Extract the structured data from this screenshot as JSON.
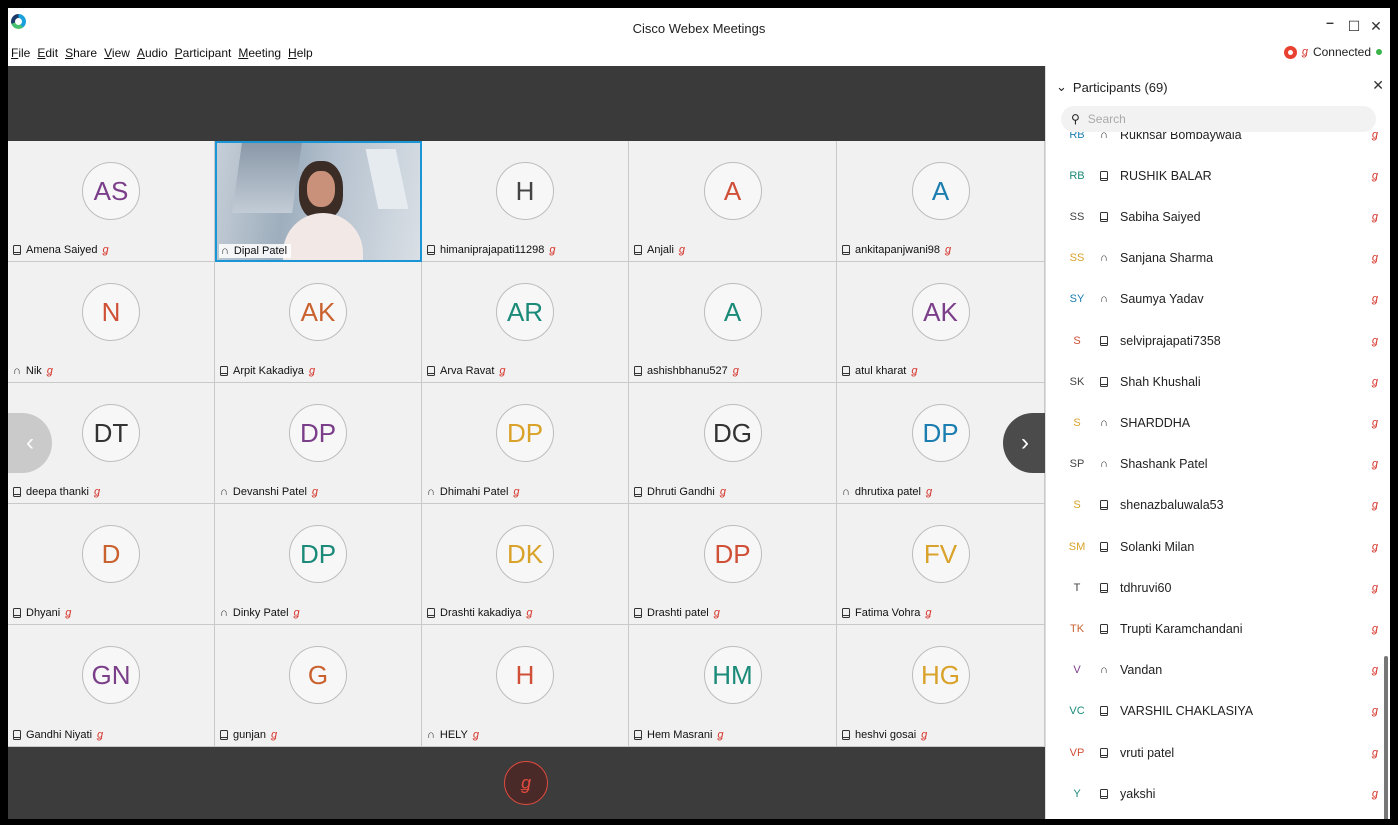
{
  "app": {
    "title": "Cisco Webex Meetings"
  },
  "menu": [
    "File",
    "Edit",
    "Share",
    "View",
    "Audio",
    "Participant",
    "Meeting",
    "Help"
  ],
  "menu_underline": [
    "F",
    "E",
    "S",
    "V",
    "A",
    "P",
    "M",
    "H"
  ],
  "status": {
    "label": "Connected"
  },
  "grid": [
    {
      "initials": "AS",
      "name": "Amena Saiyed",
      "color": "#7b3f8a",
      "device": "phone",
      "muted": true
    },
    {
      "initials": "",
      "name": "Dipal Patel",
      "color": "#333333",
      "device": "headset",
      "muted": false,
      "video": true
    },
    {
      "initials": "H",
      "name": "himaniprajapati11298",
      "color": "#444444",
      "device": "phone",
      "muted": true
    },
    {
      "initials": "A",
      "name": "Anjali",
      "color": "#d04f37",
      "device": "phone",
      "muted": true
    },
    {
      "initials": "A",
      "name": "ankitapanjwani98",
      "color": "#1c7eb0",
      "device": "phone",
      "muted": true
    },
    {
      "initials": "N",
      "name": "Nik",
      "color": "#d04f37",
      "device": "headset",
      "muted": true
    },
    {
      "initials": "AK",
      "name": "Arpit Kakadiya",
      "color": "#c9622f",
      "device": "phone",
      "muted": true
    },
    {
      "initials": "AR",
      "name": "Arva Ravat",
      "color": "#1b8a78",
      "device": "phone",
      "muted": true
    },
    {
      "initials": "A",
      "name": "ashishbhanu527",
      "color": "#1b8a78",
      "device": "phone",
      "muted": true
    },
    {
      "initials": "AK",
      "name": "atul kharat",
      "color": "#7b3f8a",
      "device": "phone",
      "muted": true
    },
    {
      "initials": "DT",
      "name": "deepa thanki",
      "color": "#333333",
      "device": "phone",
      "muted": true
    },
    {
      "initials": "DP",
      "name": "Devanshi Patel",
      "color": "#7b3f8a",
      "device": "headset",
      "muted": true
    },
    {
      "initials": "DP",
      "name": "Dhimahi Patel",
      "color": "#d9a22a",
      "device": "headset",
      "muted": true
    },
    {
      "initials": "DG",
      "name": "Dhruti Gandhi",
      "color": "#333333",
      "device": "phone",
      "muted": true
    },
    {
      "initials": "DP",
      "name": "dhrutixa patel",
      "color": "#1c7eb0",
      "device": "headset",
      "muted": true
    },
    {
      "initials": "D",
      "name": "Dhyani",
      "color": "#c9622f",
      "device": "phone",
      "muted": true
    },
    {
      "initials": "DP",
      "name": "Dinky Patel",
      "color": "#1b8a78",
      "device": "headset",
      "muted": true
    },
    {
      "initials": "DK",
      "name": "Drashti kakadiya",
      "color": "#d9a22a",
      "device": "phone",
      "muted": true
    },
    {
      "initials": "DP",
      "name": "Drashti patel",
      "color": "#d04f37",
      "device": "phone",
      "muted": true
    },
    {
      "initials": "FV",
      "name": "Fatima Vohra",
      "color": "#d9a22a",
      "device": "phone",
      "muted": true
    },
    {
      "initials": "GN",
      "name": "Gandhi Niyati",
      "color": "#7b3f8a",
      "device": "phone",
      "muted": true
    },
    {
      "initials": "G",
      "name": "gunjan",
      "color": "#c9622f",
      "device": "phone",
      "muted": true
    },
    {
      "initials": "H",
      "name": "HELY",
      "color": "#d04f37",
      "device": "headset",
      "muted": true
    },
    {
      "initials": "HM",
      "name": "Hem Masrani",
      "color": "#1b8a78",
      "device": "phone",
      "muted": true
    },
    {
      "initials": "HG",
      "name": "heshvi gosai",
      "color": "#d9a22a",
      "device": "phone",
      "muted": true
    }
  ],
  "panel": {
    "title": "Participants (69)",
    "search_placeholder": "Search",
    "participants": [
      {
        "initials": "RB",
        "name": "Rukhsar Bombaywala",
        "color": "#1c7eb0",
        "device": "headset"
      },
      {
        "initials": "RB",
        "name": "RUSHIK BALAR",
        "color": "#1b8a78",
        "device": "phone"
      },
      {
        "initials": "SS",
        "name": "Sabiha Saiyed",
        "color": "#444444",
        "device": "phone"
      },
      {
        "initials": "SS",
        "name": "Sanjana Sharma",
        "color": "#d9a22a",
        "device": "headset"
      },
      {
        "initials": "SY",
        "name": "Saumya Yadav",
        "color": "#1c7eb0",
        "device": "headset"
      },
      {
        "initials": "S",
        "name": "selviprajapati7358",
        "color": "#d04f37",
        "device": "phone"
      },
      {
        "initials": "SK",
        "name": "Shah Khushali",
        "color": "#444444",
        "device": "phone"
      },
      {
        "initials": "S",
        "name": "SHARDDHA",
        "color": "#d9a22a",
        "device": "headset"
      },
      {
        "initials": "SP",
        "name": "Shashank Patel",
        "color": "#444444",
        "device": "headset"
      },
      {
        "initials": "S",
        "name": "shenazbaluwala53",
        "color": "#d9a22a",
        "device": "phone"
      },
      {
        "initials": "SM",
        "name": "Solanki Milan",
        "color": "#d9a22a",
        "device": "phone"
      },
      {
        "initials": "T",
        "name": "tdhruvi60",
        "color": "#444444",
        "device": "phone"
      },
      {
        "initials": "TK",
        "name": "Trupti Karamchandani",
        "color": "#c9622f",
        "device": "phone"
      },
      {
        "initials": "V",
        "name": "Vandan",
        "color": "#7b3f8a",
        "device": "headset"
      },
      {
        "initials": "VC",
        "name": "VARSHIL CHAKLASIYA",
        "color": "#1b8a78",
        "device": "phone"
      },
      {
        "initials": "VP",
        "name": "vruti patel",
        "color": "#d04f37",
        "device": "phone"
      },
      {
        "initials": "Y",
        "name": "yakshi",
        "color": "#1b8a78",
        "device": "phone"
      }
    ]
  },
  "icons": {
    "mute": "mic-muted-icon",
    "headset": "headset-icon",
    "phone": "phone-device-icon"
  }
}
